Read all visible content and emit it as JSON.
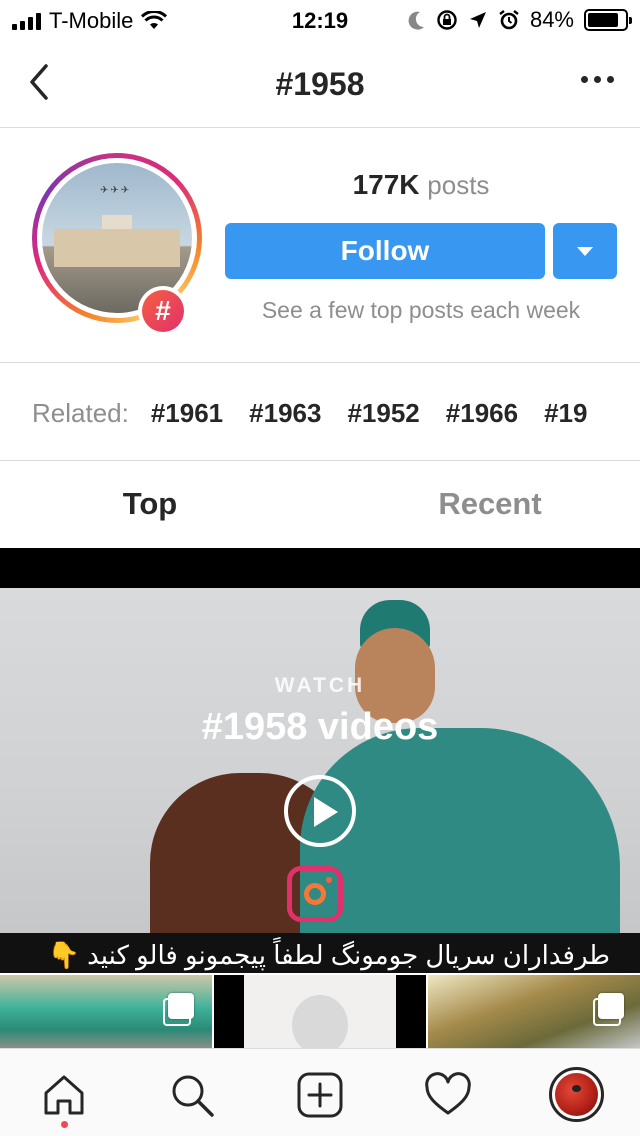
{
  "status_bar": {
    "carrier": "T-Mobile",
    "time": "12:19",
    "battery_percent": "84%",
    "battery_level": 0.84,
    "icons": [
      "signal-icon",
      "wifi-icon",
      "moon-icon",
      "rotation-lock-icon",
      "location-arrow-icon",
      "alarm-icon",
      "battery-icon"
    ]
  },
  "nav": {
    "title": "#1958",
    "back_icon": "chevron-left-icon",
    "more_icon": "more-horizontal-icon"
  },
  "header": {
    "post_count": "177K",
    "post_label": "posts",
    "follow_label": "Follow",
    "hint": "See a few top posts each week",
    "badge_symbol": "#"
  },
  "related": {
    "label": "Related:",
    "tags": [
      "#1961",
      "#1963",
      "#1952",
      "#1966",
      "#19"
    ]
  },
  "tabs": {
    "top": "Top",
    "recent": "Recent"
  },
  "video": {
    "watch_label": "WATCH",
    "title": "#1958 videos",
    "subtitle": "طرفداران سریال جومونگ لطفاً پیجمونو فالو کنید 👇"
  },
  "bottom_nav": {
    "items": [
      "home-icon",
      "search-icon",
      "add-post-icon",
      "activity-heart-icon",
      "profile-avatar"
    ]
  },
  "colors": {
    "accent": "#3897f0",
    "text": "#262626",
    "muted": "#8e8e8e",
    "divider": "#dbdbdb",
    "notification": "#ed4956"
  }
}
